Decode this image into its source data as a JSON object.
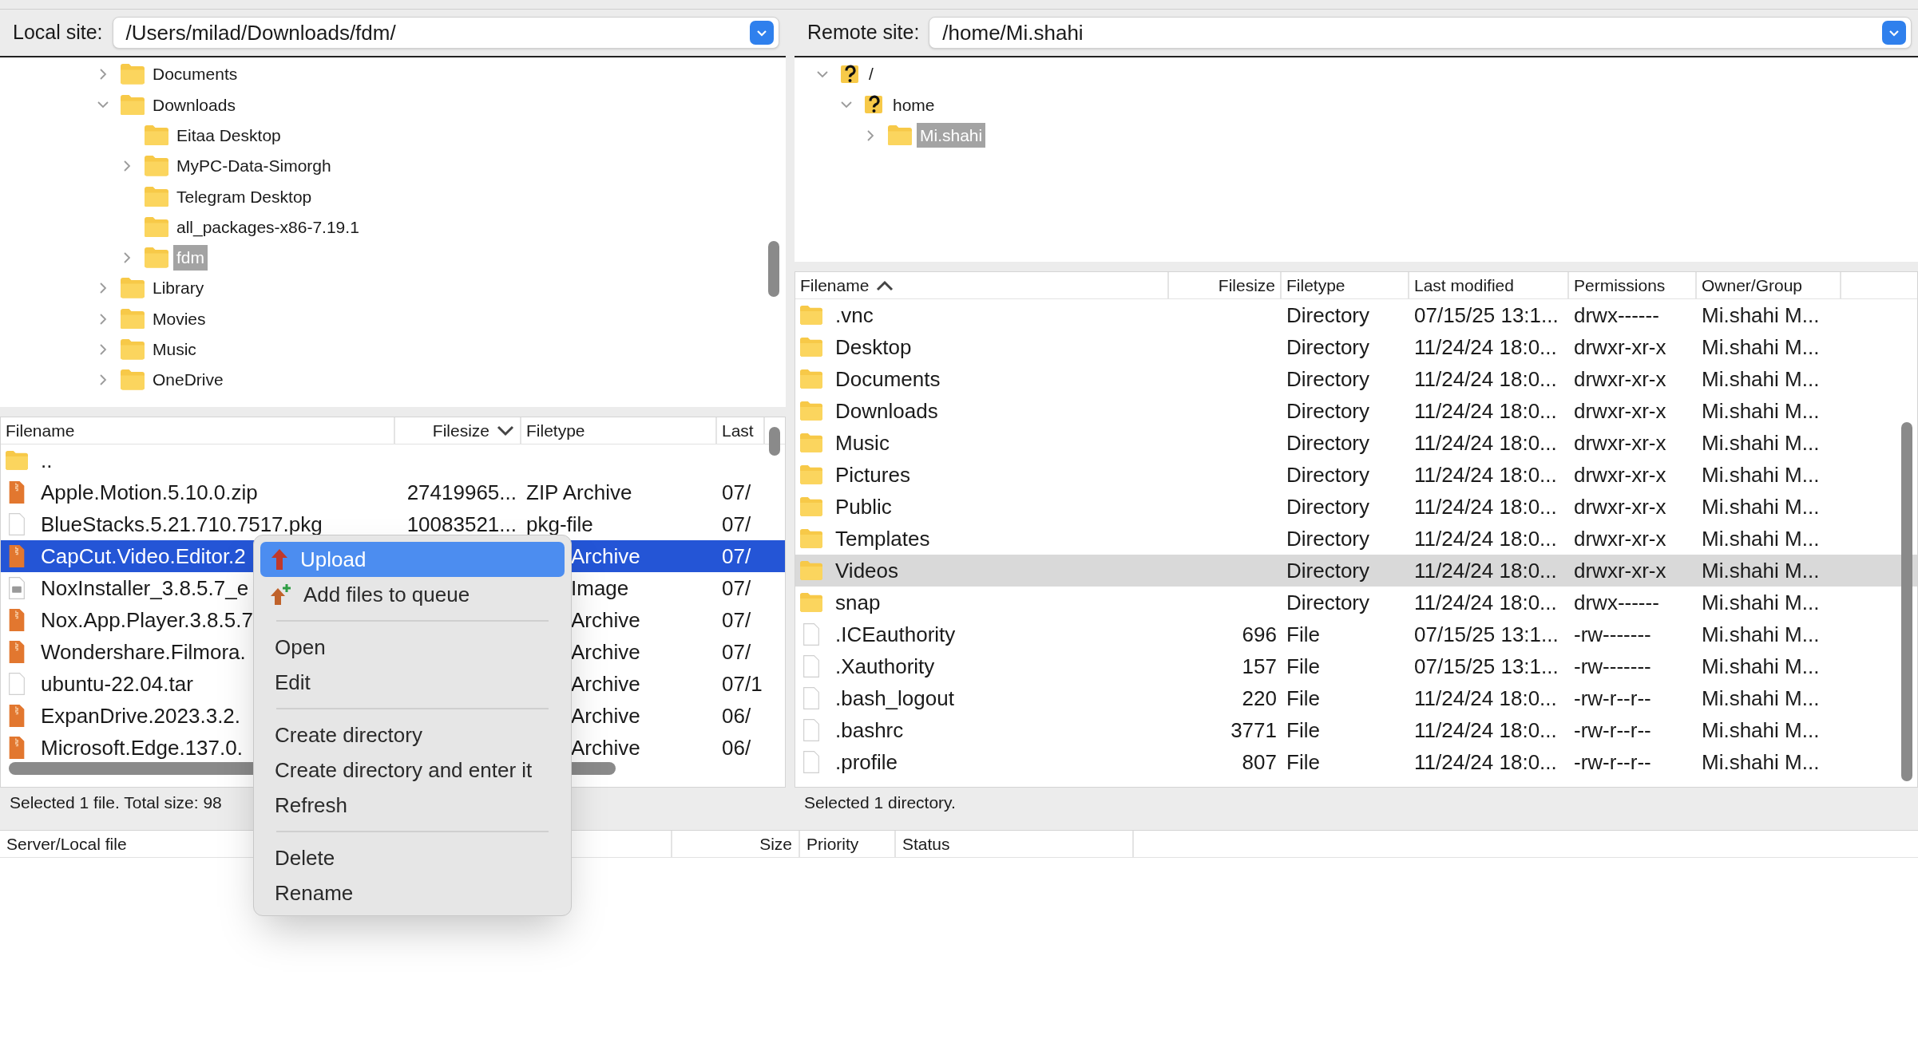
{
  "local_site": {
    "label": "Local site:",
    "path": "/Users/milad/Downloads/fdm/"
  },
  "local_tree": [
    {
      "name": "Documents",
      "kind": "branch",
      "expanded": false,
      "selected": false
    },
    {
      "name": "Downloads",
      "kind": "branch",
      "expanded": true,
      "selected": false,
      "children": [
        {
          "name": "Eitaa Desktop",
          "kind": "leaf",
          "selected": false
        },
        {
          "name": "MyPC-Data-Simorgh",
          "kind": "branch",
          "expanded": false,
          "selected": false
        },
        {
          "name": "Telegram Desktop",
          "kind": "leaf",
          "selected": false
        },
        {
          "name": "all_packages-x86-7.19.1",
          "kind": "leaf",
          "selected": false
        },
        {
          "name": "fdm",
          "kind": "branch",
          "expanded": false,
          "selected": true
        }
      ]
    },
    {
      "name": "Library",
      "kind": "branch",
      "expanded": false,
      "selected": false
    },
    {
      "name": "Movies",
      "kind": "branch",
      "expanded": false,
      "selected": false
    },
    {
      "name": "Music",
      "kind": "branch",
      "expanded": false,
      "selected": false
    },
    {
      "name": "OneDrive",
      "kind": "branch",
      "expanded": false,
      "selected": false
    }
  ],
  "local_files": {
    "columns": [
      {
        "label": "Filename",
        "sorted": false
      },
      {
        "label": "Filesize",
        "sorted": true,
        "descending": true
      },
      {
        "label": "Filetype",
        "sorted": false
      },
      {
        "label": "Last",
        "sorted": false
      }
    ],
    "rows": [
      {
        "kind": "folder",
        "name": "..",
        "selected": false
      },
      {
        "kind": "archive",
        "name": "Apple.Motion.5.10.0.zip",
        "size": "27419965...",
        "type": "ZIP Archive",
        "modified": "07/",
        "selected": false
      },
      {
        "kind": "plain",
        "name": "BlueStacks.5.21.710.7517.pkg",
        "size": "10083521...",
        "type": "pkg-file",
        "modified": "07/",
        "selected": false
      },
      {
        "kind": "archive",
        "name": "CapCut.Video.Editor.2",
        "type": "Archive",
        "modified": "07/",
        "selected": true
      },
      {
        "kind": "disk-image",
        "name": "NoxInstaller_3.8.5.7_e",
        "type": "Image",
        "modified": "07/",
        "selected": false
      },
      {
        "kind": "archive",
        "name": "Nox.App.Player.3.8.5.7",
        "type": "Archive",
        "modified": "07/",
        "selected": false
      },
      {
        "kind": "archive",
        "name": "Wondershare.Filmora.",
        "type": "Archive",
        "modified": "07/",
        "selected": false
      },
      {
        "kind": "plain",
        "name": "ubuntu-22.04.tar",
        "type": "Archive",
        "modified": "07/1",
        "selected": false
      },
      {
        "kind": "archive",
        "name": "ExpanDrive.2023.3.2.",
        "type": "Archive",
        "modified": "06/",
        "selected": false
      },
      {
        "kind": "archive",
        "name": "Microsoft.Edge.137.0.",
        "type": "Archive",
        "modified": "06/",
        "selected": false
      }
    ],
    "status": "Selected 1 file. Total size: 98"
  },
  "remote_site": {
    "label": "Remote site:",
    "path": "/home/Mi.shahi"
  },
  "remote_tree": [
    {
      "name": "/",
      "kind": "unknown",
      "expanded": true,
      "selected": false,
      "children": [
        {
          "name": "home",
          "kind": "unknown",
          "expanded": true,
          "selected": false,
          "children": [
            {
              "name": "Mi.shahi",
              "kind": "folder",
              "expanded": false,
              "selected": true
            }
          ]
        }
      ]
    }
  ],
  "remote_files": {
    "columns": [
      {
        "label": "Filename",
        "sorted": true,
        "descending": false
      },
      {
        "label": "Filesize",
        "sorted": false
      },
      {
        "label": "Filetype",
        "sorted": false
      },
      {
        "label": "Last modified",
        "sorted": false
      },
      {
        "label": "Permissions",
        "sorted": false
      },
      {
        "label": "Owner/Group",
        "sorted": false
      }
    ],
    "rows": [
      {
        "kind": "folder",
        "name": ".vnc",
        "type": "Directory",
        "modified": "07/15/25 13:1...",
        "permissions": "drwx------",
        "owner": "Mi.shahi M...",
        "selected": false
      },
      {
        "kind": "folder",
        "name": "Desktop",
        "type": "Directory",
        "modified": "11/24/24 18:0...",
        "permissions": "drwxr-xr-x",
        "owner": "Mi.shahi M...",
        "selected": false
      },
      {
        "kind": "folder",
        "name": "Documents",
        "type": "Directory",
        "modified": "11/24/24 18:0...",
        "permissions": "drwxr-xr-x",
        "owner": "Mi.shahi M...",
        "selected": false
      },
      {
        "kind": "folder",
        "name": "Downloads",
        "type": "Directory",
        "modified": "11/24/24 18:0...",
        "permissions": "drwxr-xr-x",
        "owner": "Mi.shahi M...",
        "selected": false
      },
      {
        "kind": "folder",
        "name": "Music",
        "type": "Directory",
        "modified": "11/24/24 18:0...",
        "permissions": "drwxr-xr-x",
        "owner": "Mi.shahi M...",
        "selected": false
      },
      {
        "kind": "folder",
        "name": "Pictures",
        "type": "Directory",
        "modified": "11/24/24 18:0...",
        "permissions": "drwxr-xr-x",
        "owner": "Mi.shahi M...",
        "selected": false
      },
      {
        "kind": "folder",
        "name": "Public",
        "type": "Directory",
        "modified": "11/24/24 18:0...",
        "permissions": "drwxr-xr-x",
        "owner": "Mi.shahi M...",
        "selected": false
      },
      {
        "kind": "folder",
        "name": "Templates",
        "type": "Directory",
        "modified": "11/24/24 18:0...",
        "permissions": "drwxr-xr-x",
        "owner": "Mi.shahi M...",
        "selected": false
      },
      {
        "kind": "folder",
        "name": "Videos",
        "type": "Directory",
        "modified": "11/24/24 18:0...",
        "permissions": "drwxr-xr-x",
        "owner": "Mi.shahi M...",
        "selected": true
      },
      {
        "kind": "folder",
        "name": "snap",
        "type": "Directory",
        "modified": "11/24/24 18:0...",
        "permissions": "drwx------",
        "owner": "Mi.shahi M...",
        "selected": false
      },
      {
        "kind": "plain",
        "name": ".ICEauthority",
        "size": "696",
        "type": "File",
        "modified": "07/15/25 13:1...",
        "permissions": "-rw-------",
        "owner": "Mi.shahi M...",
        "selected": false
      },
      {
        "kind": "plain",
        "name": ".Xauthority",
        "size": "157",
        "type": "File",
        "modified": "07/15/25 13:1...",
        "permissions": "-rw-------",
        "owner": "Mi.shahi M...",
        "selected": false
      },
      {
        "kind": "plain",
        "name": ".bash_logout",
        "size": "220",
        "type": "File",
        "modified": "11/24/24 18:0...",
        "permissions": "-rw-r--r--",
        "owner": "Mi.shahi M...",
        "selected": false
      },
      {
        "kind": "plain",
        "name": ".bashrc",
        "size": "3771",
        "type": "File",
        "modified": "11/24/24 18:0...",
        "permissions": "-rw-r--r--",
        "owner": "Mi.shahi M...",
        "selected": false
      },
      {
        "kind": "plain",
        "name": ".profile",
        "size": "807",
        "type": "File",
        "modified": "11/24/24 18:0...",
        "permissions": "-rw-r--r--",
        "owner": "Mi.shahi M...",
        "selected": false
      }
    ],
    "status": "Selected 1 directory."
  },
  "queue": {
    "columns": [
      "Server/Local file",
      "Size",
      "Priority",
      "Status"
    ]
  },
  "context_menu": [
    {
      "kind": "upload",
      "label": "Upload",
      "highlighted": true
    },
    {
      "kind": "queue",
      "label": "Add files to queue",
      "highlighted": false
    },
    {
      "kind": "separator"
    },
    {
      "kind": "item",
      "label": "Open",
      "highlighted": false
    },
    {
      "kind": "item",
      "label": "Edit",
      "highlighted": false
    },
    {
      "kind": "separator"
    },
    {
      "kind": "item",
      "label": "Create directory",
      "highlighted": false
    },
    {
      "kind": "item",
      "label": "Create directory and enter it",
      "highlighted": false
    },
    {
      "kind": "item",
      "label": "Refresh",
      "highlighted": false
    },
    {
      "kind": "separator"
    },
    {
      "kind": "item",
      "label": "Delete",
      "highlighted": false
    },
    {
      "kind": "item",
      "label": "Rename",
      "highlighted": false
    }
  ]
}
